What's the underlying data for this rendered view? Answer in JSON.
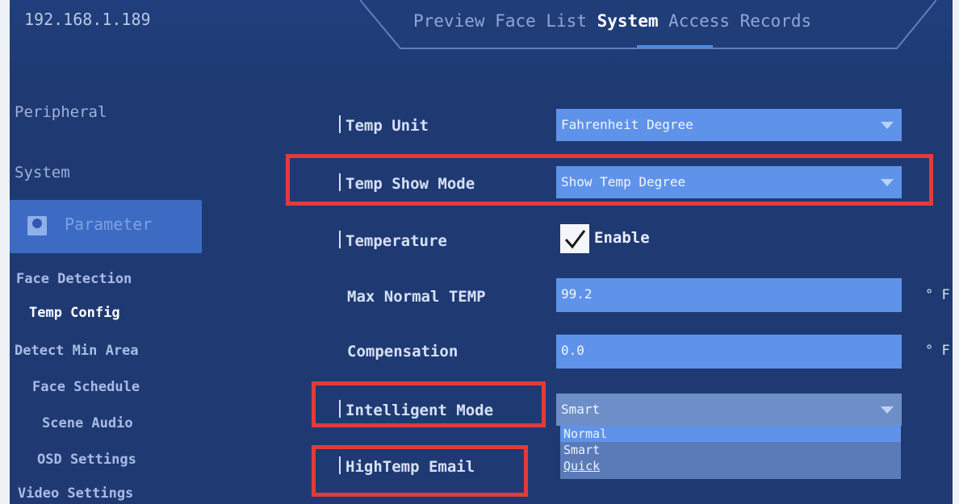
{
  "header": {
    "ip": "192.168.1.189",
    "tabs": [
      {
        "label": "Preview"
      },
      {
        "label": "Face List"
      },
      {
        "label": "System",
        "active": true
      },
      {
        "label": "Access Records"
      }
    ]
  },
  "sidebar": {
    "peripheral": "Peripheral",
    "system": "System",
    "parameter": "Parameter",
    "sub_items": [
      "Face Detection",
      "Temp Config",
      "Detect Min Area",
      "Face Schedule",
      "Scene Audio",
      "OSD Settings",
      "Video Settings"
    ]
  },
  "form": {
    "temp_unit": {
      "label": "Temp Unit",
      "value": "Fahrenheit Degree"
    },
    "temp_show_mode": {
      "label": "Temp Show Mode",
      "value": "Show Temp Degree"
    },
    "temperature": {
      "label": "Temperature",
      "checkbox_label": "Enable",
      "checked": true
    },
    "max_normal_temp": {
      "label": "Max Normal TEMP",
      "value": "99.2",
      "unit": "° F"
    },
    "compensation": {
      "label": "Compensation",
      "value": "0.0",
      "unit": "° F"
    },
    "intelligent_mode": {
      "label": "Intelligent Mode",
      "value": "Smart",
      "options": [
        "Normal",
        "Smart",
        "Quick"
      ]
    },
    "hightemp_email": {
      "label": "HighTemp Email"
    }
  },
  "colors": {
    "accent": "#5f93ea",
    "highlight_box": "#e33a3a",
    "background": "#1f3a73"
  }
}
